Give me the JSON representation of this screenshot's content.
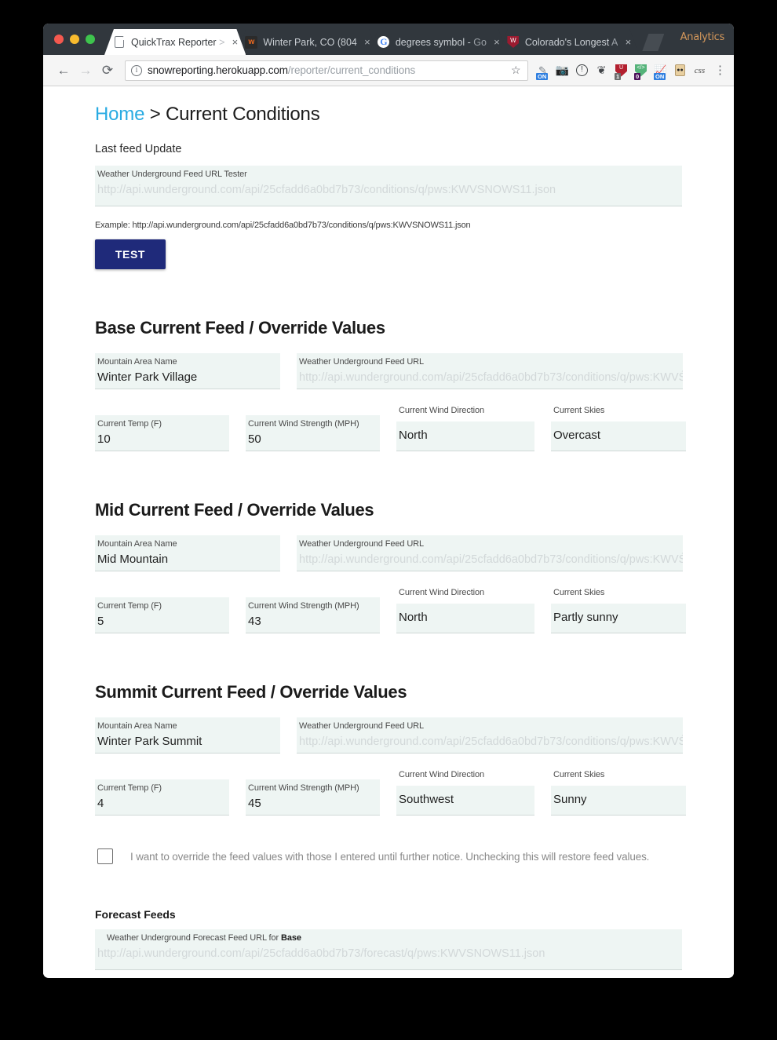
{
  "browser": {
    "tabs": [
      {
        "title": "QuickTrax Reporter",
        "title_dim": " >",
        "favicon": "document-icon",
        "active": true
      },
      {
        "title": "Winter Park, CO (804",
        "title_dim": "",
        "favicon": "wunderground-icon",
        "active": false
      },
      {
        "title": "degrees symbol - ",
        "title_dim": "Go",
        "favicon": "google-icon",
        "active": false
      },
      {
        "title": "Colorado's Longest ",
        "title_dim": "A",
        "favicon": "shield-icon",
        "active": false
      }
    ],
    "close_glyph": "×",
    "watermark": "Analytics",
    "nav": {
      "back": "←",
      "forward": "→",
      "reload": "⟳"
    },
    "omnibox": {
      "info_glyph": "ⓘ",
      "url_host": "snowreporting.herokuapp.com",
      "url_path": "/reporter/current_conditions",
      "star_glyph": "☆"
    },
    "extensions": [
      {
        "name": "bandwidth-on-icon",
        "glyph": "✐",
        "badge": "ON",
        "badge_style": "badge-on"
      },
      {
        "name": "screenshot-camera-icon",
        "glyph": "▣",
        "badge": "",
        "badge_style": ""
      },
      {
        "name": "info-circle-icon",
        "glyph": "!",
        "badge": "",
        "badge_style": ""
      },
      {
        "name": "evernote-elephant-icon",
        "glyph": "❦",
        "badge": "",
        "badge_style": ""
      },
      {
        "name": "adblock-shield-icon",
        "glyph": "UB",
        "badge": "1",
        "badge_style": "badge-grey"
      },
      {
        "name": "code-shield-icon",
        "glyph": "</>",
        "badge": "0",
        "badge_style": "badge-purple"
      },
      {
        "name": "analytics-chart-icon",
        "glyph": "↗",
        "badge": "ON",
        "badge_style": "badge-on"
      },
      {
        "name": "robot-icon",
        "glyph": "■■",
        "badge": "",
        "badge_style": ""
      },
      {
        "name": "css-viewer-icon",
        "glyph": "css",
        "badge": "",
        "badge_style": ""
      }
    ],
    "menu_glyph": "⋮"
  },
  "page": {
    "breadcrumb": {
      "home": "Home",
      "separator": " > ",
      "current": "Current Conditions"
    },
    "last_feed_update": "Last feed Update",
    "tester": {
      "label": "Weather Underground Feed URL Tester",
      "placeholder": "http://api.wunderground.com/api/25cfadd6a0bd7b73/conditions/q/pws:KWVSNOWS11.json",
      "value": ""
    },
    "example_line": "Example: http://api.wunderground.com/api/25cfadd6a0bd7b73/conditions/q/pws:KWVSNOWS11.json",
    "test_button": "TEST",
    "field_labels": {
      "mountain_area_name": "Mountain Area Name",
      "feed_url": "Weather Underground Feed URL",
      "current_temp": "Current Temp (F)",
      "current_wind": "Current Wind Strength (MPH)",
      "current_direction": "Current Wind Direction",
      "current_skies": "Current Skies"
    },
    "feed_url_placeholder": "http://api.wunderground.com/api/25cfadd6a0bd7b73/conditions/q/pws:KWVŚ",
    "sections": [
      {
        "title": "Base Current Feed / Override Values",
        "area_name": "Winter Park Village",
        "temp": "10",
        "wind": "50",
        "direction": "North",
        "skies": "Overcast"
      },
      {
        "title": "Mid Current Feed / Override Values",
        "area_name": "Mid Mountain",
        "temp": "5",
        "wind": "43",
        "direction": "North",
        "skies": "Partly sunny"
      },
      {
        "title": "Summit Current Feed / Override Values",
        "area_name": "Winter Park Summit",
        "temp": "4",
        "wind": "45",
        "direction": "Southwest",
        "skies": "Sunny"
      }
    ],
    "override": {
      "checked": false,
      "label": "I want to override the feed values with those I entered until further notice. Unchecking this will restore feed values."
    },
    "forecast": {
      "title": "Forecast Feeds",
      "label_prefix": "Weather Underground Forecast Feed URL for ",
      "label_bold": "Base",
      "placeholder": "http://api.wunderground.com/api/25cfadd6a0bd7b73/forecast/q/pws:KWVSNOWS11.json"
    }
  },
  "colors": {
    "accent_link": "#29abe2",
    "button_primary": "#1f2a7a",
    "field_bg": "#eef5f3",
    "tabstrip": "#31373d"
  }
}
